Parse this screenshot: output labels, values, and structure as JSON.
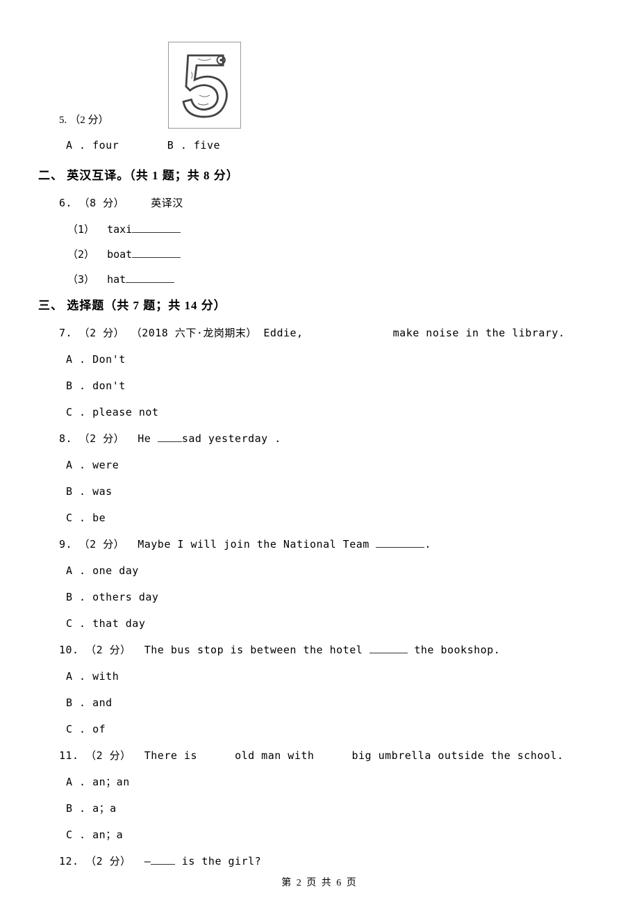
{
  "q5": {
    "number": "5.",
    "points": "（2 分）",
    "options": {
      "a": "A . four",
      "b": "B . five"
    }
  },
  "section2": {
    "heading": "二、 英汉互译。（共 1 题；共 8 分）"
  },
  "q6": {
    "number": "6.",
    "points": "（8 分）",
    "instruction": "英译汉",
    "items": {
      "i1": {
        "label": "（1）",
        "word": "taxi"
      },
      "i2": {
        "label": "（2）",
        "word": "boat"
      },
      "i3": {
        "label": "（3）",
        "word": "hat"
      }
    }
  },
  "section3": {
    "heading": "三、 选择题（共 7 题；共 14 分）"
  },
  "q7": {
    "number": "7.",
    "points": "（2 分）",
    "source": "（2018 六下·龙岗期末）",
    "text_before": "Eddie,",
    "text_after": "make noise in the library.",
    "options": {
      "a": "A . Don't",
      "b": "B . don't",
      "c": "C . please not"
    }
  },
  "q8": {
    "number": "8.",
    "points": "（2 分）",
    "text_before": "He ",
    "text_after": "sad yesterday .",
    "options": {
      "a": "A . were",
      "b": "B . was",
      "c": "C . be"
    }
  },
  "q9": {
    "number": "9.",
    "points": "（2 分）",
    "text_before": "Maybe I will join the National Team ",
    "text_after": ".",
    "options": {
      "a": "A . one day",
      "b": "B . others day",
      "c": "C . that day"
    }
  },
  "q10": {
    "number": "10.",
    "points": "（2 分）",
    "text_before": "The bus stop is between the hotel ",
    "text_after": " the bookshop.",
    "options": {
      "a": "A . with",
      "b": "B . and",
      "c": "C . of"
    }
  },
  "q11": {
    "number": "11.",
    "points": "（2 分）",
    "part1": "There is",
    "part2": "old man with",
    "part3": "big umbrella outside the school.",
    "options": {
      "a": "A . an；an",
      "b": "B . a；a",
      "c": "C . an；a"
    }
  },
  "q12": {
    "number": "12.",
    "points": "（2 分）",
    "text_before": "—",
    "text_after": " is the girl?"
  },
  "footer": "第 2 页 共 6 页"
}
